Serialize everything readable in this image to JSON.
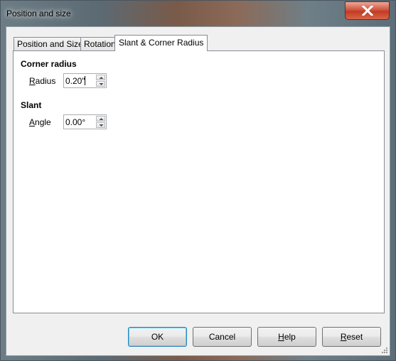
{
  "window": {
    "title": "Position and size"
  },
  "tabs": [
    {
      "label": "Position and Size",
      "active": false
    },
    {
      "label": "Rotation",
      "active": false
    },
    {
      "label": "Slant & Corner Radius",
      "active": true
    }
  ],
  "corner_radius": {
    "heading": "Corner radius",
    "radius_label_underlined": "R",
    "radius_label_rest": "adius",
    "radius_value": "0.20\""
  },
  "slant": {
    "heading": "Slant",
    "angle_label_underlined": "A",
    "angle_label_rest": "ngle",
    "angle_value": "0.00°"
  },
  "buttons": {
    "ok": "OK",
    "cancel": "Cancel",
    "help_underlined": "H",
    "help_rest": "elp",
    "reset_underlined": "R",
    "reset_rest": "eset"
  },
  "icons": {
    "close": "close-x-icon",
    "spin_up": "triangle-up-icon",
    "spin_down": "triangle-down-icon",
    "resize": "resize-grip-icon"
  },
  "colors": {
    "close_button": "#c23b22",
    "default_button_border": "#3c7fb1",
    "panel_background": "#ffffff",
    "dialog_background": "#f0f0f0"
  }
}
